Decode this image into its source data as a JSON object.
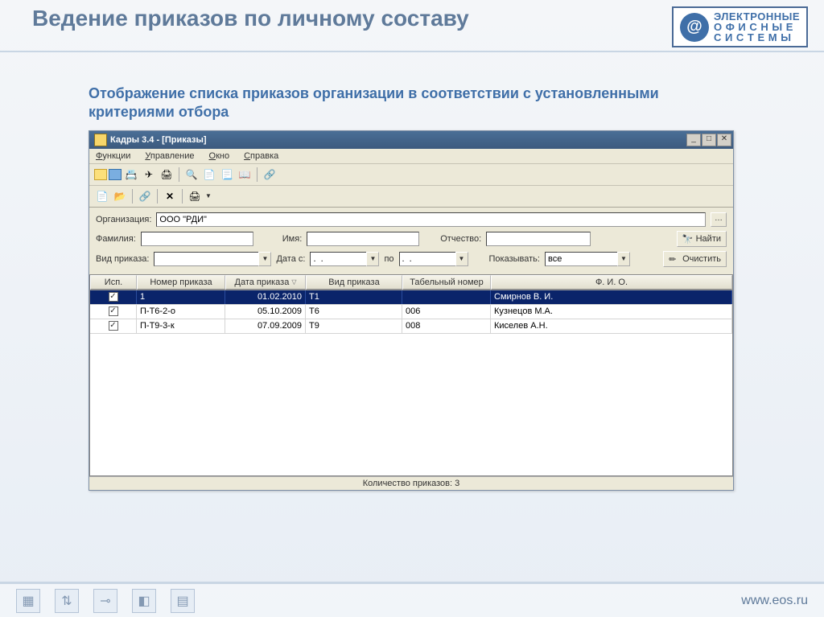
{
  "slide": {
    "title": "Ведение приказов по личному составу",
    "subtitle": "Отображение списка приказов организации в соответствии с установленными критериями отбора"
  },
  "brand": {
    "line1": "ЭЛЕКТРОННЫЕ",
    "line2": "О Ф И С Н Ы Е",
    "line3": "С И С Т Е М Ы"
  },
  "window": {
    "title": "Кадры 3.4 - [Приказы]",
    "menus": {
      "functions": "Функции",
      "manage": "Управление",
      "window": "Окно",
      "help": "Справка"
    }
  },
  "form": {
    "org_label": "Организация:",
    "org_value": "ООО \"РДИ\"",
    "lastname_label": "Фамилия:",
    "firstname_label": "Имя:",
    "patronymic_label": "Отчество:",
    "find_label": "Найти",
    "type_label": "Вид приказа:",
    "date_from_label": "Дата с:",
    "date_mask": ".  .",
    "date_to_label": "по",
    "show_label": "Показывать:",
    "show_value": "все",
    "clear_label": "Очистить"
  },
  "grid": {
    "headers": {
      "isp": "Исп.",
      "num": "Номер приказа",
      "date": "Дата приказа",
      "type": "Вид приказа",
      "tab": "Табельный номер",
      "fio": "Ф. И. О."
    },
    "rows": [
      {
        "isp": true,
        "num": "1",
        "date": "01.02.2010",
        "type": "Т1",
        "tab": "",
        "fio": "Смирнов В. И.",
        "selected": true
      },
      {
        "isp": true,
        "num": "П-Т6-2-о",
        "date": "05.10.2009",
        "type": "Т6",
        "tab": "006",
        "fio": "Кузнецов М.А.",
        "selected": false
      },
      {
        "isp": true,
        "num": "П-Т9-3-к",
        "date": "07.09.2009",
        "type": "Т9",
        "tab": "008",
        "fio": "Киселев А.Н.",
        "selected": false
      }
    ]
  },
  "statusbar": {
    "text": "Количество приказов: 3"
  },
  "footer": {
    "url": "www.eos.ru"
  }
}
